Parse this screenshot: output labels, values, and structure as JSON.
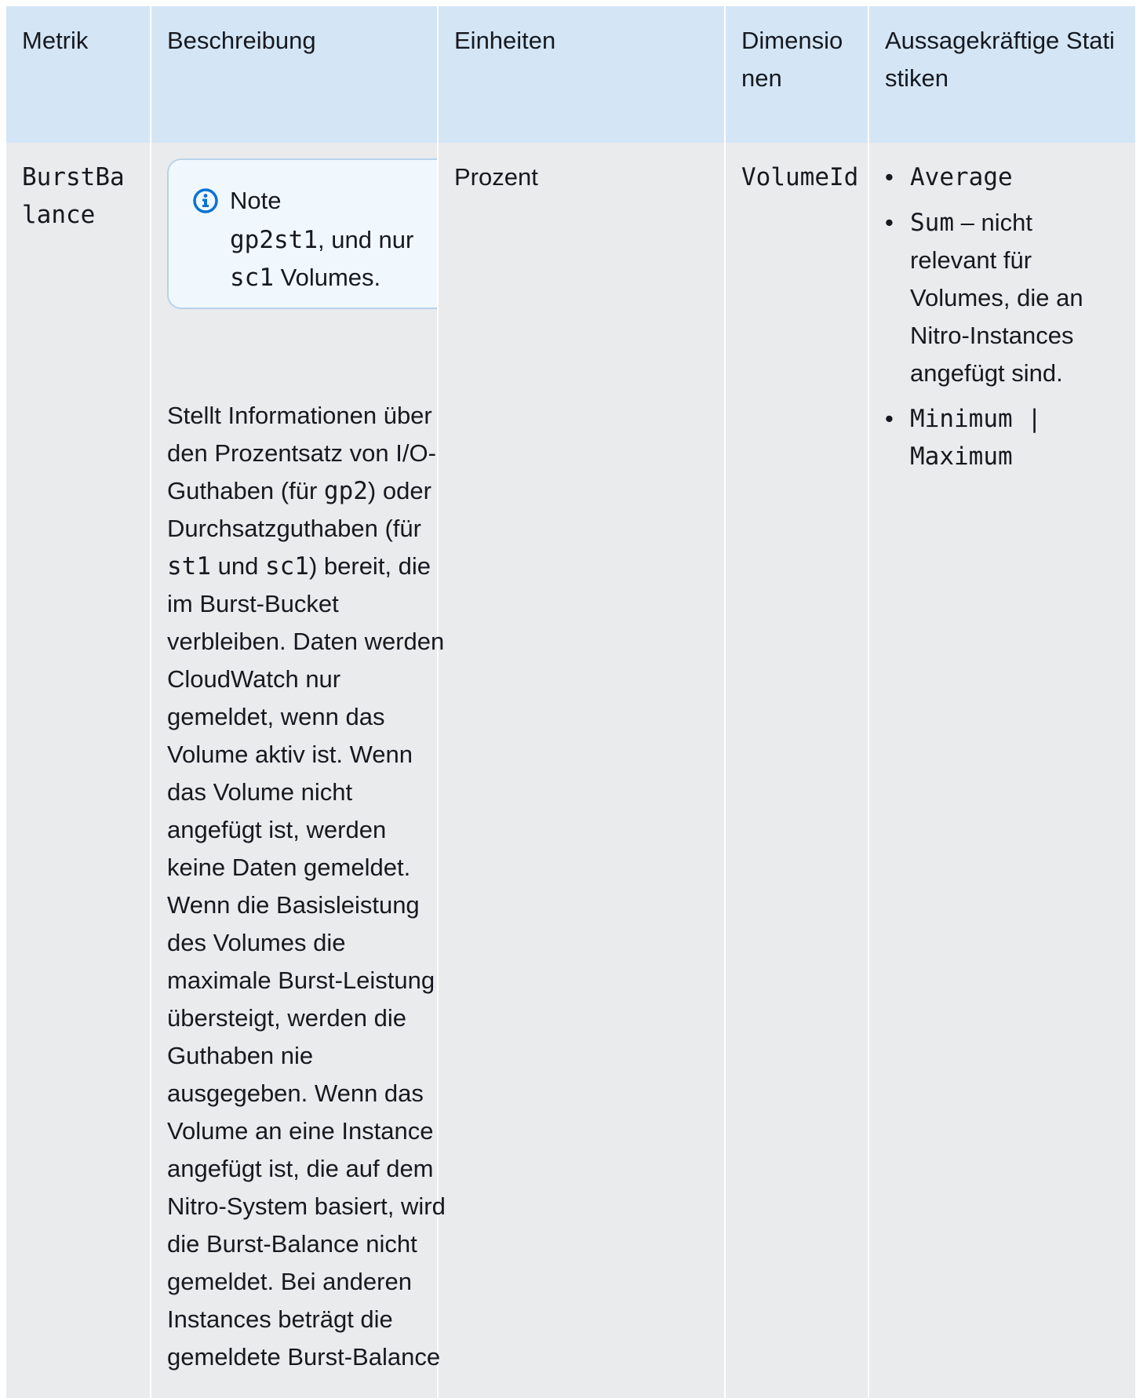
{
  "table": {
    "headers": {
      "metric": "Metrik",
      "description": "Beschreibung",
      "units": "Einheiten",
      "dimensions": "Dimensionen",
      "statistics": "Aussagekräftige Statistiken"
    },
    "rows": [
      {
        "metric": "BurstBalance",
        "note": {
          "title": "Note",
          "code1": "gp2",
          "code2": "st1",
          "text1": ", und nur ",
          "code3": "sc1",
          "text2": " Volumes."
        },
        "description": {
          "p1": "Stellt Informationen über den Prozentsatz von I/O-Guthaben (für ",
          "c1": "gp2",
          "p2": ") oder Durchsatzguthaben (für ",
          "c2": "st1",
          "p3": " und ",
          "c3": "sc1",
          "p4": ") bereit, die im Burst-Bucket verbleiben. Daten werden CloudWatch nur gemeldet, wenn das Volume aktiv ist. Wenn das Volume nicht angefügt ist, werden keine Daten gemeldet. Wenn die Basisleistung des Volumes die maximale Burst-Leistung übersteigt, werden die Guthaben nie ausgegeben. Wenn das Volume an eine Instance angefügt ist, die auf dem Nitro-System basiert, wird die Burst-Balance nicht gemeldet. Bei anderen Instances beträgt die gemeldete Burst-Balance"
        },
        "units": "Prozent",
        "dimension": "VolumeId",
        "statistics": {
          "s1": "Average",
          "s2_code": "Sum",
          "s2_text": " – nicht relevant für Volumes, die an Nitro-Instances angefügt sind.",
          "s3": "Minimum | Maximum"
        }
      }
    ]
  },
  "colors": {
    "header_bg": "#d4e6f6",
    "cell_bg": "#eaebed",
    "note_bg": "#f1f8fd",
    "note_border": "#b5d3ec",
    "info_icon": "#0972d3"
  },
  "icons": {
    "note": "info-circle-icon"
  }
}
